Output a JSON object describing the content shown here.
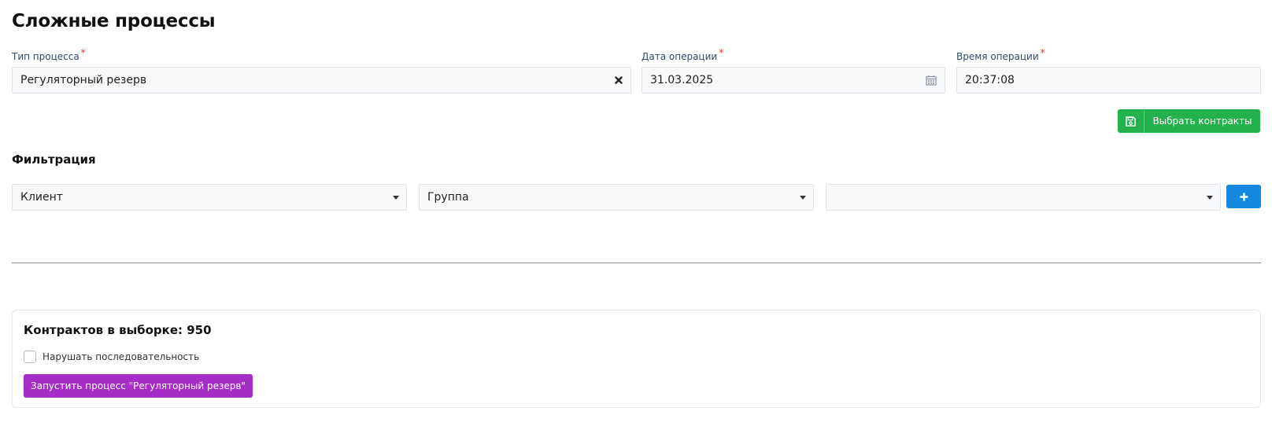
{
  "page": {
    "title": "Сложные процессы"
  },
  "form": {
    "process_type": {
      "label": "Тип процесса",
      "required_mark": "*",
      "value": "Регуляторный резерв"
    },
    "operation_date": {
      "label": "Дата операции",
      "required_mark": "*",
      "value": "31.03.2025"
    },
    "operation_time": {
      "label": "Время операции",
      "required_mark": "*",
      "value": "20:37:08"
    },
    "select_contracts_label": "Выбрать контракты"
  },
  "filter": {
    "title": "Фильтрация",
    "selects": [
      {
        "value": "Клиент"
      },
      {
        "value": "Группа"
      },
      {
        "value": ""
      }
    ]
  },
  "summary": {
    "contracts_label": "Контрактов в выборке: 950",
    "break_sequence_label": "Нарушать последовательность",
    "break_sequence_checked": false,
    "run_button_label": "Запустить процесс \"Регуляторный резерв\""
  },
  "colors": {
    "green_button": "#22b14c",
    "blue_button": "#1588e0",
    "purple_button": "#a62dc8",
    "required": "#e0342c"
  },
  "icons": {
    "clear": "close-icon",
    "date": "calendar-icon",
    "save": "save-icon",
    "add": "plus-icon",
    "dropdown": "chevron-down-icon"
  }
}
